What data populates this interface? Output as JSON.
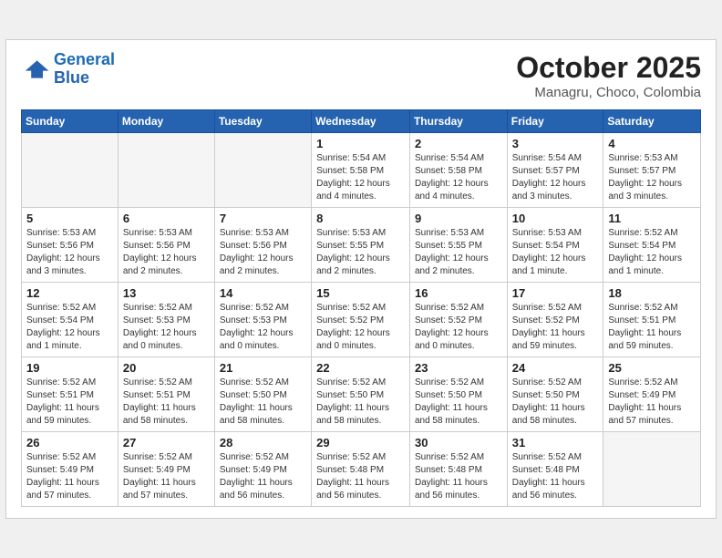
{
  "header": {
    "logo_line1": "General",
    "logo_line2": "Blue",
    "month": "October 2025",
    "location": "Managru, Choco, Colombia"
  },
  "weekdays": [
    "Sunday",
    "Monday",
    "Tuesday",
    "Wednesday",
    "Thursday",
    "Friday",
    "Saturday"
  ],
  "weeks": [
    [
      {
        "day": "",
        "empty": true
      },
      {
        "day": "",
        "empty": true
      },
      {
        "day": "",
        "empty": true
      },
      {
        "day": "1",
        "sunrise": "5:54 AM",
        "sunset": "5:58 PM",
        "daylight": "12 hours and 4 minutes."
      },
      {
        "day": "2",
        "sunrise": "5:54 AM",
        "sunset": "5:58 PM",
        "daylight": "12 hours and 4 minutes."
      },
      {
        "day": "3",
        "sunrise": "5:54 AM",
        "sunset": "5:57 PM",
        "daylight": "12 hours and 3 minutes."
      },
      {
        "day": "4",
        "sunrise": "5:53 AM",
        "sunset": "5:57 PM",
        "daylight": "12 hours and 3 minutes."
      }
    ],
    [
      {
        "day": "5",
        "sunrise": "5:53 AM",
        "sunset": "5:56 PM",
        "daylight": "12 hours and 3 minutes."
      },
      {
        "day": "6",
        "sunrise": "5:53 AM",
        "sunset": "5:56 PM",
        "daylight": "12 hours and 2 minutes."
      },
      {
        "day": "7",
        "sunrise": "5:53 AM",
        "sunset": "5:56 PM",
        "daylight": "12 hours and 2 minutes."
      },
      {
        "day": "8",
        "sunrise": "5:53 AM",
        "sunset": "5:55 PM",
        "daylight": "12 hours and 2 minutes."
      },
      {
        "day": "9",
        "sunrise": "5:53 AM",
        "sunset": "5:55 PM",
        "daylight": "12 hours and 2 minutes."
      },
      {
        "day": "10",
        "sunrise": "5:53 AM",
        "sunset": "5:54 PM",
        "daylight": "12 hours and 1 minute."
      },
      {
        "day": "11",
        "sunrise": "5:52 AM",
        "sunset": "5:54 PM",
        "daylight": "12 hours and 1 minute."
      }
    ],
    [
      {
        "day": "12",
        "sunrise": "5:52 AM",
        "sunset": "5:54 PM",
        "daylight": "12 hours and 1 minute."
      },
      {
        "day": "13",
        "sunrise": "5:52 AM",
        "sunset": "5:53 PM",
        "daylight": "12 hours and 0 minutes."
      },
      {
        "day": "14",
        "sunrise": "5:52 AM",
        "sunset": "5:53 PM",
        "daylight": "12 hours and 0 minutes."
      },
      {
        "day": "15",
        "sunrise": "5:52 AM",
        "sunset": "5:52 PM",
        "daylight": "12 hours and 0 minutes."
      },
      {
        "day": "16",
        "sunrise": "5:52 AM",
        "sunset": "5:52 PM",
        "daylight": "12 hours and 0 minutes."
      },
      {
        "day": "17",
        "sunrise": "5:52 AM",
        "sunset": "5:52 PM",
        "daylight": "11 hours and 59 minutes."
      },
      {
        "day": "18",
        "sunrise": "5:52 AM",
        "sunset": "5:51 PM",
        "daylight": "11 hours and 59 minutes."
      }
    ],
    [
      {
        "day": "19",
        "sunrise": "5:52 AM",
        "sunset": "5:51 PM",
        "daylight": "11 hours and 59 minutes."
      },
      {
        "day": "20",
        "sunrise": "5:52 AM",
        "sunset": "5:51 PM",
        "daylight": "11 hours and 58 minutes."
      },
      {
        "day": "21",
        "sunrise": "5:52 AM",
        "sunset": "5:50 PM",
        "daylight": "11 hours and 58 minutes."
      },
      {
        "day": "22",
        "sunrise": "5:52 AM",
        "sunset": "5:50 PM",
        "daylight": "11 hours and 58 minutes."
      },
      {
        "day": "23",
        "sunrise": "5:52 AM",
        "sunset": "5:50 PM",
        "daylight": "11 hours and 58 minutes."
      },
      {
        "day": "24",
        "sunrise": "5:52 AM",
        "sunset": "5:50 PM",
        "daylight": "11 hours and 58 minutes."
      },
      {
        "day": "25",
        "sunrise": "5:52 AM",
        "sunset": "5:49 PM",
        "daylight": "11 hours and 57 minutes."
      }
    ],
    [
      {
        "day": "26",
        "sunrise": "5:52 AM",
        "sunset": "5:49 PM",
        "daylight": "11 hours and 57 minutes."
      },
      {
        "day": "27",
        "sunrise": "5:52 AM",
        "sunset": "5:49 PM",
        "daylight": "11 hours and 57 minutes."
      },
      {
        "day": "28",
        "sunrise": "5:52 AM",
        "sunset": "5:49 PM",
        "daylight": "11 hours and 56 minutes."
      },
      {
        "day": "29",
        "sunrise": "5:52 AM",
        "sunset": "5:48 PM",
        "daylight": "11 hours and 56 minutes."
      },
      {
        "day": "30",
        "sunrise": "5:52 AM",
        "sunset": "5:48 PM",
        "daylight": "11 hours and 56 minutes."
      },
      {
        "day": "31",
        "sunrise": "5:52 AM",
        "sunset": "5:48 PM",
        "daylight": "11 hours and 56 minutes."
      },
      {
        "day": "",
        "empty": true
      }
    ]
  ]
}
